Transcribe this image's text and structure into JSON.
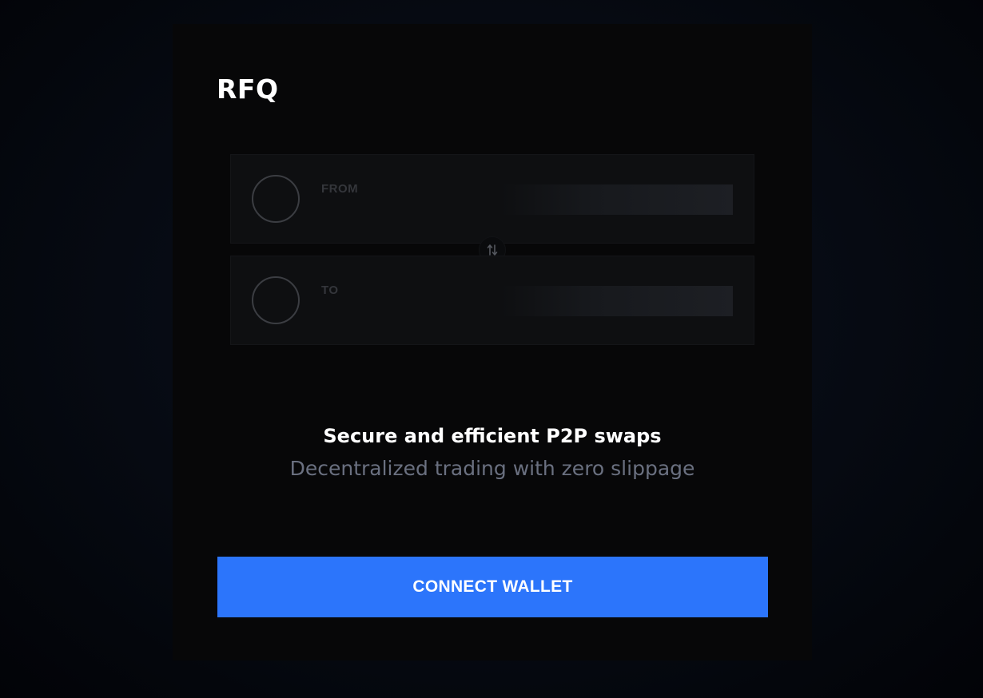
{
  "header": {
    "title": "RFQ"
  },
  "swap": {
    "from_label": "FROM",
    "to_label": "TO",
    "switch_icon": "swap-arrows-icon"
  },
  "promo": {
    "headline": "Secure and efficient P2P swaps",
    "subline": "Decentralized trading with zero slippage"
  },
  "actions": {
    "connect_label": "CONNECT WALLET"
  },
  "colors": {
    "accent": "#2c75fb",
    "card_background": "#070708",
    "muted_text": "#6a7080"
  }
}
